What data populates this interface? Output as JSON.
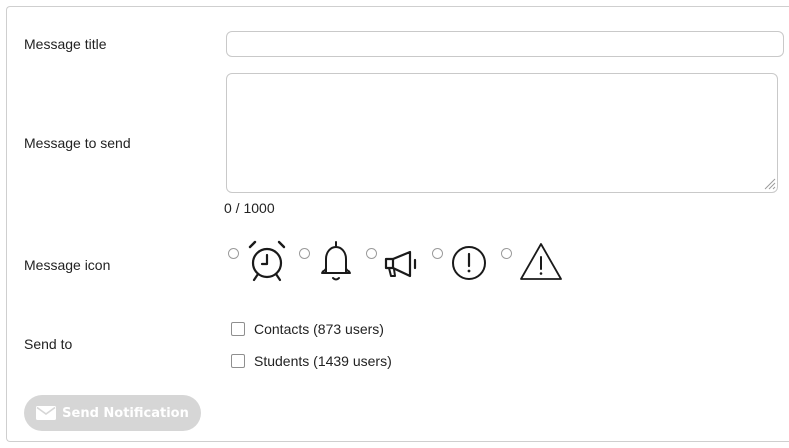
{
  "form": {
    "title_label": "Message title",
    "title_value": "",
    "message_label": "Message to send",
    "message_value": "",
    "counter": "0 / 1000",
    "icon_label": "Message icon",
    "icons": [
      "alarm-clock-icon",
      "bell-icon",
      "megaphone-icon",
      "exclamation-circle-icon",
      "warning-triangle-icon"
    ],
    "send_to_label": "Send to",
    "recipients": [
      {
        "label": "Contacts (873 users)",
        "checked": false
      },
      {
        "label": "Students (1439 users)",
        "checked": false
      }
    ],
    "send_button_label": "Send Notification",
    "send_button_enabled": false
  },
  "colors": {
    "button_disabled_bg": "#d6d6d6",
    "border": "#c9c9c9",
    "text": "#222222",
    "icon": "#1a1a1a"
  }
}
